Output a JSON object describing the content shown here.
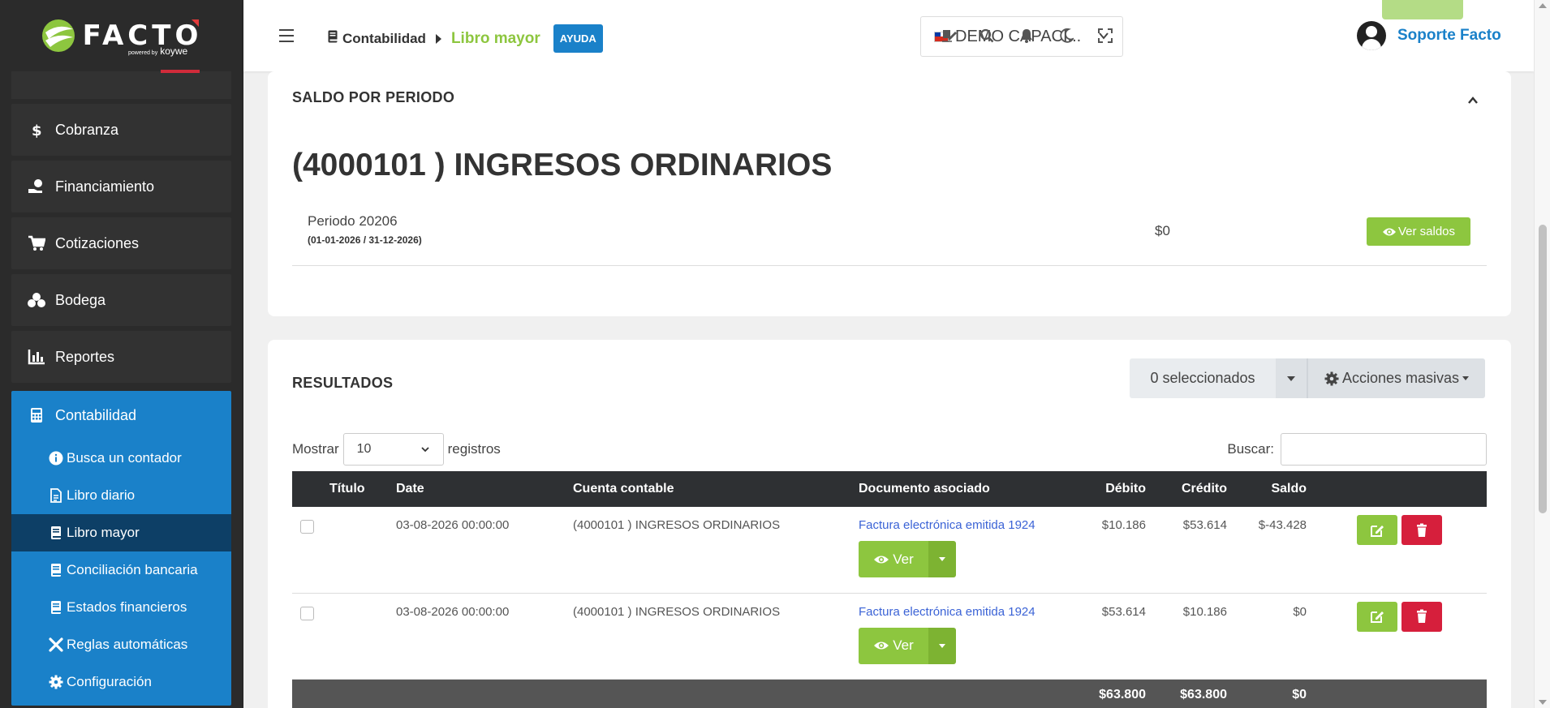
{
  "brand": {
    "name": "FACTO",
    "powered": "powered by",
    "by": "koywe"
  },
  "sidebar": {
    "items": [
      {
        "label": "Cobranza"
      },
      {
        "label": "Financiamiento"
      },
      {
        "label": "Cotizaciones"
      },
      {
        "label": "Bodega"
      },
      {
        "label": "Reportes"
      }
    ],
    "contabilidad": {
      "label": "Contabilidad",
      "subitems": [
        {
          "label": "Busca un contador"
        },
        {
          "label": "Libro diario"
        },
        {
          "label": "Libro mayor",
          "active": true
        },
        {
          "label": "Conciliación bancaria"
        },
        {
          "label": "Estados financieros"
        },
        {
          "label": "Reglas automáticas"
        },
        {
          "label": "Configuración"
        }
      ]
    }
  },
  "header": {
    "breadcrumb": {
      "parent": "Contabilidad",
      "current": "Libro mayor"
    },
    "help_label": "AYUDA",
    "company": "DEMO CAPACI...",
    "user_name": "Soporte Facto",
    "colors": {
      "accent": "#1a81c9",
      "green": "#8dc63f",
      "danger": "#d61f3c"
    }
  },
  "saldo": {
    "title": "SALDO POR PERIODO",
    "account_title": "(4000101 ) INGRESOS ORDINARIOS",
    "period_label": "Periodo 20206",
    "period_dates": "(01-01-2026 / 31-12-2026)",
    "amount": "$0",
    "button": "Ver saldos"
  },
  "results": {
    "title": "RESULTADOS",
    "selected": "0 seleccionados",
    "bulk_actions": "Acciones masivas",
    "show_label": "Mostrar",
    "show_value": "10",
    "records_label": "registros",
    "search_label": "Buscar:",
    "columns": {
      "titulo": "Título",
      "date": "Date",
      "cuenta": "Cuenta contable",
      "documento": "Documento asociado",
      "debito": "Débito",
      "credito": "Crédito",
      "saldo": "Saldo"
    },
    "rows": [
      {
        "date": "03-08-2026 00:00:00",
        "cuenta": "(4000101 ) INGRESOS ORDINARIOS",
        "documento": "Factura electrónica emitida 1924",
        "ver": "Ver",
        "debito": "$10.186",
        "credito": "$53.614",
        "saldo": "$-43.428"
      },
      {
        "date": "03-08-2026 00:00:00",
        "cuenta": "(4000101 ) INGRESOS ORDINARIOS",
        "documento": "Factura electrónica emitida 1924",
        "ver": "Ver",
        "debito": "$53.614",
        "credito": "$10.186",
        "saldo": "$0"
      }
    ],
    "totals": {
      "debito": "$63.800",
      "credito": "$63.800",
      "saldo": "$0"
    }
  }
}
